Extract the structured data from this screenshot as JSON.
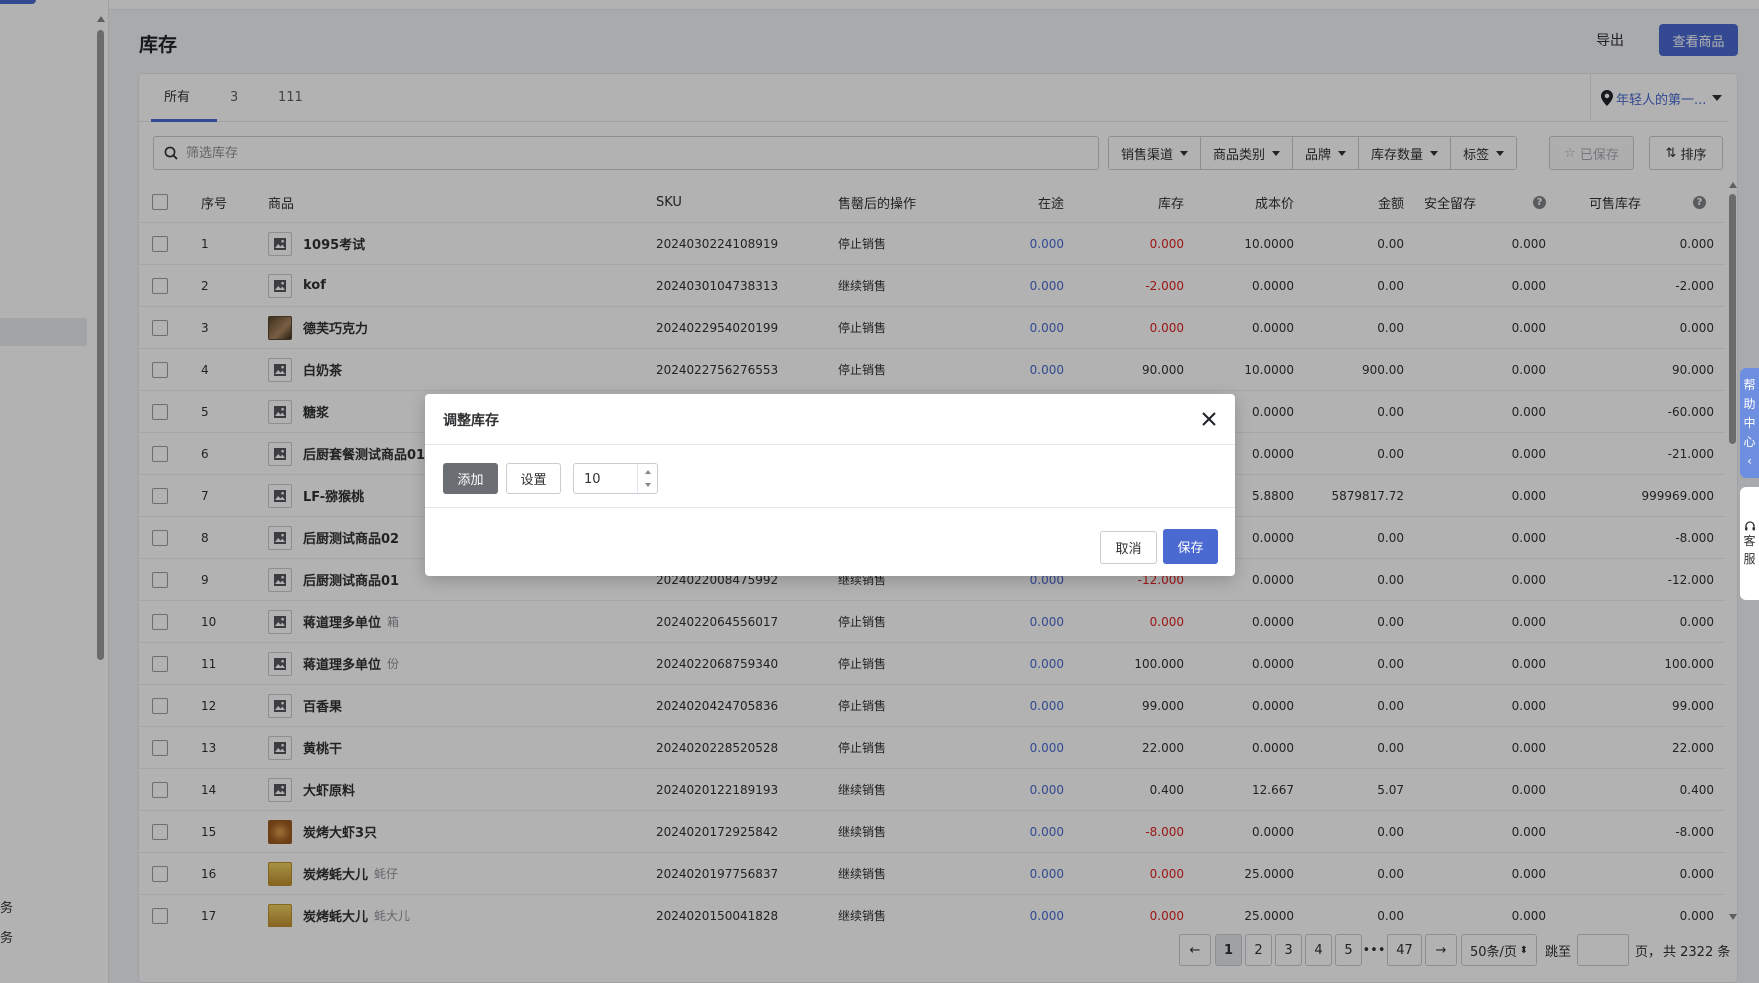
{
  "sidebar": {
    "bottom_items": [
      {
        "label": "务"
      },
      {
        "label": "务"
      }
    ]
  },
  "header": {
    "title": "库存",
    "export_label": "导出",
    "view_button_label": "查看商品"
  },
  "tabs": [
    {
      "label": "所有"
    },
    {
      "label": "3"
    },
    {
      "label": "111"
    }
  ],
  "location": {
    "label": "年轻人的第一..."
  },
  "search": {
    "placeholder": "筛选库存",
    "value": ""
  },
  "filters": [
    {
      "label": "销售渠道"
    },
    {
      "label": "商品类别"
    },
    {
      "label": "品牌"
    },
    {
      "label": "库存数量"
    },
    {
      "label": "标签"
    }
  ],
  "saved_label": "已保存",
  "sort_label": "排序",
  "columns": {
    "index": "序号",
    "product": "商品",
    "sku": "SKU",
    "after_sold": "售罄后的操作",
    "in_transit": "在途",
    "stock": "库存",
    "cost": "成本价",
    "amount": "金额",
    "safety": "安全留存",
    "available": "可售库存"
  },
  "rows": [
    {
      "index": "1",
      "name": "1095考试",
      "unit": "",
      "thumb": "placeholder",
      "sku": "2024030224108919",
      "action": "停止销售",
      "transit": "0.000",
      "stock": "0.000",
      "stock_neg": true,
      "cost": "10.0000",
      "amount": "0.00",
      "safety": "0.000",
      "available": "0.000"
    },
    {
      "index": "2",
      "name": "kof",
      "unit": "",
      "thumb": "placeholder",
      "sku": "2024030104738313",
      "action": "继续销售",
      "transit": "0.000",
      "stock": "-2.000",
      "stock_neg": true,
      "cost": "0.0000",
      "amount": "0.00",
      "safety": "0.000",
      "available": "-2.000"
    },
    {
      "index": "3",
      "name": "德芙巧克力",
      "unit": "",
      "thumb": "photo",
      "sku": "2024022954020199",
      "action": "停止销售",
      "transit": "0.000",
      "stock": "0.000",
      "stock_neg": true,
      "cost": "0.0000",
      "amount": "0.00",
      "safety": "0.000",
      "available": "0.000"
    },
    {
      "index": "4",
      "name": "白奶茶",
      "unit": "",
      "thumb": "placeholder",
      "sku": "2024022756276553",
      "action": "停止销售",
      "transit": "0.000",
      "stock": "90.000",
      "stock_neg": false,
      "cost": "10.0000",
      "amount": "900.00",
      "safety": "0.000",
      "available": "90.000"
    },
    {
      "index": "5",
      "name": "糖浆",
      "unit": "",
      "thumb": "placeholder",
      "sku": "",
      "action": "",
      "transit": "",
      "stock": "",
      "stock_neg": false,
      "cost": "0.0000",
      "amount": "0.00",
      "safety": "0.000",
      "available": "-60.000"
    },
    {
      "index": "6",
      "name": "后厨套餐测试商品01",
      "unit": "",
      "thumb": "placeholder",
      "sku": "",
      "action": "",
      "transit": "",
      "stock": "",
      "stock_neg": false,
      "cost": "0.0000",
      "amount": "0.00",
      "safety": "0.000",
      "available": "-21.000"
    },
    {
      "index": "7",
      "name": "LF-猕猴桃",
      "unit": "",
      "thumb": "placeholder",
      "sku": "",
      "action": "",
      "transit": "",
      "stock": "",
      "stock_neg": false,
      "cost": "5.8800",
      "amount": "5879817.72",
      "safety": "0.000",
      "available": "999969.000"
    },
    {
      "index": "8",
      "name": "后厨测试商品02",
      "unit": "",
      "thumb": "placeholder",
      "sku": "",
      "action": "",
      "transit": "",
      "stock": "",
      "stock_neg": false,
      "cost": "0.0000",
      "amount": "0.00",
      "safety": "0.000",
      "available": "-8.000"
    },
    {
      "index": "9",
      "name": "后厨测试商品01",
      "unit": "",
      "thumb": "placeholder",
      "sku": "2024022008475992",
      "action": "继续销售",
      "transit": "0.000",
      "stock": "-12.000",
      "stock_neg": true,
      "cost": "0.0000",
      "amount": "0.00",
      "safety": "0.000",
      "available": "-12.000"
    },
    {
      "index": "10",
      "name": "蒋道理多单位",
      "unit": "箱",
      "thumb": "placeholder",
      "sku": "2024022064556017",
      "action": "停止销售",
      "transit": "0.000",
      "stock": "0.000",
      "stock_neg": true,
      "cost": "0.0000",
      "amount": "0.00",
      "safety": "0.000",
      "available": "0.000"
    },
    {
      "index": "11",
      "name": "蒋道理多单位",
      "unit": "份",
      "thumb": "placeholder",
      "sku": "2024022068759340",
      "action": "停止销售",
      "transit": "0.000",
      "stock": "100.000",
      "stock_neg": false,
      "cost": "0.0000",
      "amount": "0.00",
      "safety": "0.000",
      "available": "100.000"
    },
    {
      "index": "12",
      "name": "百香果",
      "unit": "",
      "thumb": "placeholder",
      "sku": "2024020424705836",
      "action": "停止销售",
      "transit": "0.000",
      "stock": "99.000",
      "stock_neg": false,
      "cost": "0.0000",
      "amount": "0.00",
      "safety": "0.000",
      "available": "99.000"
    },
    {
      "index": "13",
      "name": "黄桃干",
      "unit": "",
      "thumb": "placeholder",
      "sku": "2024020228520528",
      "action": "停止销售",
      "transit": "0.000",
      "stock": "22.000",
      "stock_neg": false,
      "cost": "0.0000",
      "amount": "0.00",
      "safety": "0.000",
      "available": "22.000"
    },
    {
      "index": "14",
      "name": "大虾原料",
      "unit": "",
      "thumb": "placeholder",
      "sku": "2024020122189193",
      "action": "继续销售",
      "transit": "0.000",
      "stock": "0.400",
      "stock_neg": false,
      "cost": "12.667",
      "amount": "5.07",
      "safety": "0.000",
      "available": "0.400"
    },
    {
      "index": "15",
      "name": "炭烤大虾3只",
      "unit": "",
      "thumb": "photo2",
      "sku": "2024020172925842",
      "action": "继续销售",
      "transit": "0.000",
      "stock": "-8.000",
      "stock_neg": true,
      "cost": "0.0000",
      "amount": "0.00",
      "safety": "0.000",
      "available": "-8.000"
    },
    {
      "index": "16",
      "name": "炭烤蚝大儿",
      "unit": "蚝仔",
      "thumb": "photo3",
      "sku": "2024020197756837",
      "action": "继续销售",
      "transit": "0.000",
      "stock": "0.000",
      "stock_neg": true,
      "cost": "25.0000",
      "amount": "0.00",
      "safety": "0.000",
      "available": "0.000"
    },
    {
      "index": "17",
      "name": "炭烤蚝大儿",
      "unit": "蚝大儿",
      "thumb": "photo3",
      "sku": "2024020150041828",
      "action": "继续销售",
      "transit": "0.000",
      "stock": "0.000",
      "stock_neg": true,
      "cost": "25.0000",
      "amount": "0.00",
      "safety": "0.000",
      "available": "0.000"
    }
  ],
  "pagination": {
    "pages": [
      "1",
      "2",
      "3",
      "4",
      "5"
    ],
    "ellipsis": "•••",
    "last_page": "47",
    "page_size": "50条/页",
    "jump_label": "跳至",
    "page_suffix": "页，",
    "total": "共 2322 条"
  },
  "floating": {
    "help": [
      "帮",
      "助",
      "中",
      "心",
      "‹"
    ],
    "service": [
      "客",
      "服"
    ]
  },
  "modal": {
    "title": "调整库存",
    "add_label": "添加",
    "set_label": "设置",
    "quantity": "10",
    "cancel_label": "取消",
    "save_label": "保存"
  },
  "colors": {
    "accent": "#4a6ad1",
    "negative": "#e02020"
  }
}
